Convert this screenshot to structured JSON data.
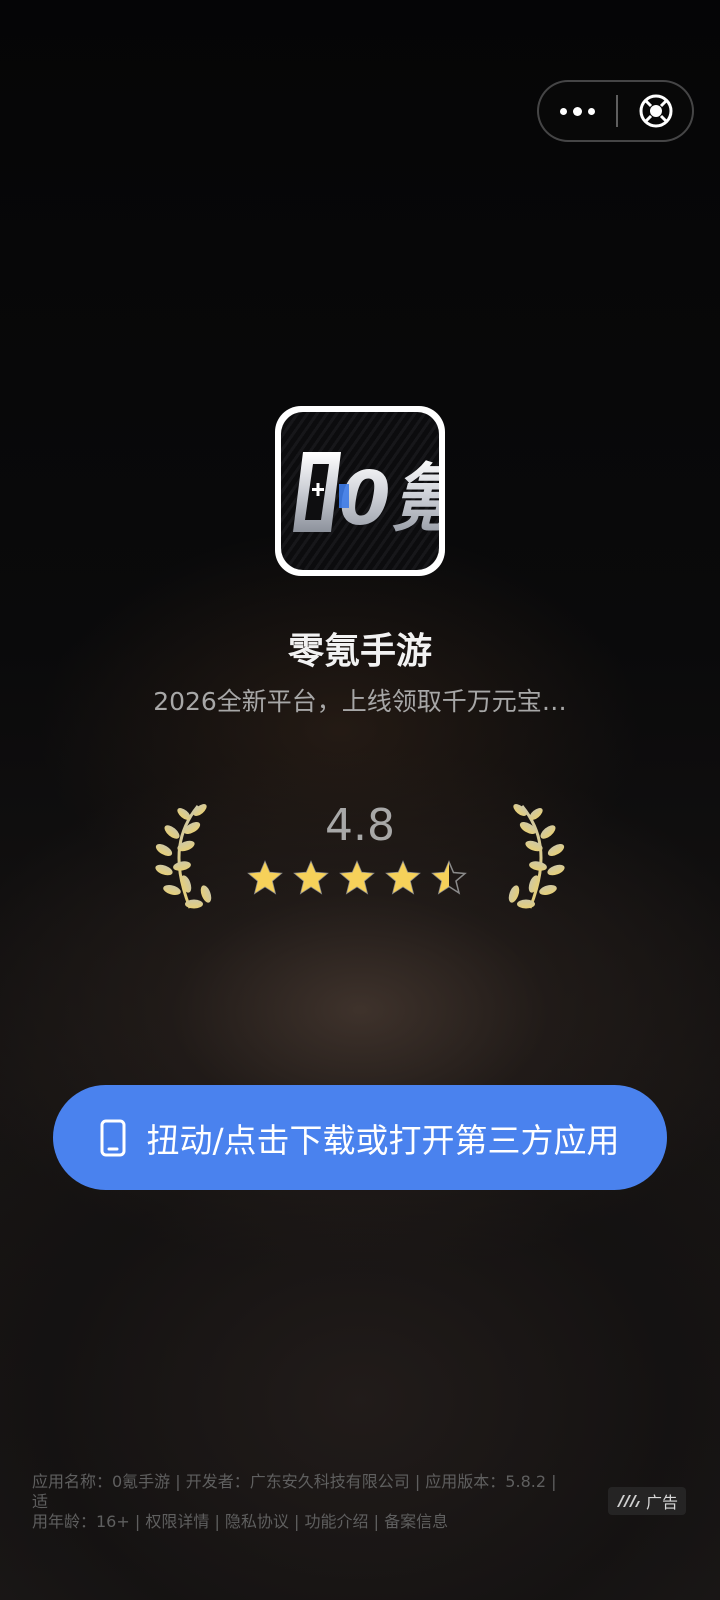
{
  "capsule": {
    "more_icon": "more-dots-icon",
    "close_icon": "target-close-icon"
  },
  "app": {
    "icon_text": "0氪",
    "name": "零氪手游",
    "description": "2026全新平台，上线领取千万元宝…"
  },
  "rating": {
    "value": "4.8",
    "stars": 4.5
  },
  "download_button": {
    "label": "扭动/点击下载或打开第三方应用",
    "icon": "phone-icon"
  },
  "footer": {
    "line1": "应用名称：0氪手游 | 开发者：广东安久科技有限公司 | 应用版本：5.8.2 | 适",
    "line2_prefix": "用年龄：16+",
    "links": [
      "权限详情",
      "隐私协议",
      "功能介绍",
      "备案信息"
    ],
    "separator": " | "
  },
  "ad": {
    "label": "广告"
  },
  "colors": {
    "button": "#4a82ee",
    "star": "#f6d15a",
    "laurel": "#d8c68a"
  }
}
